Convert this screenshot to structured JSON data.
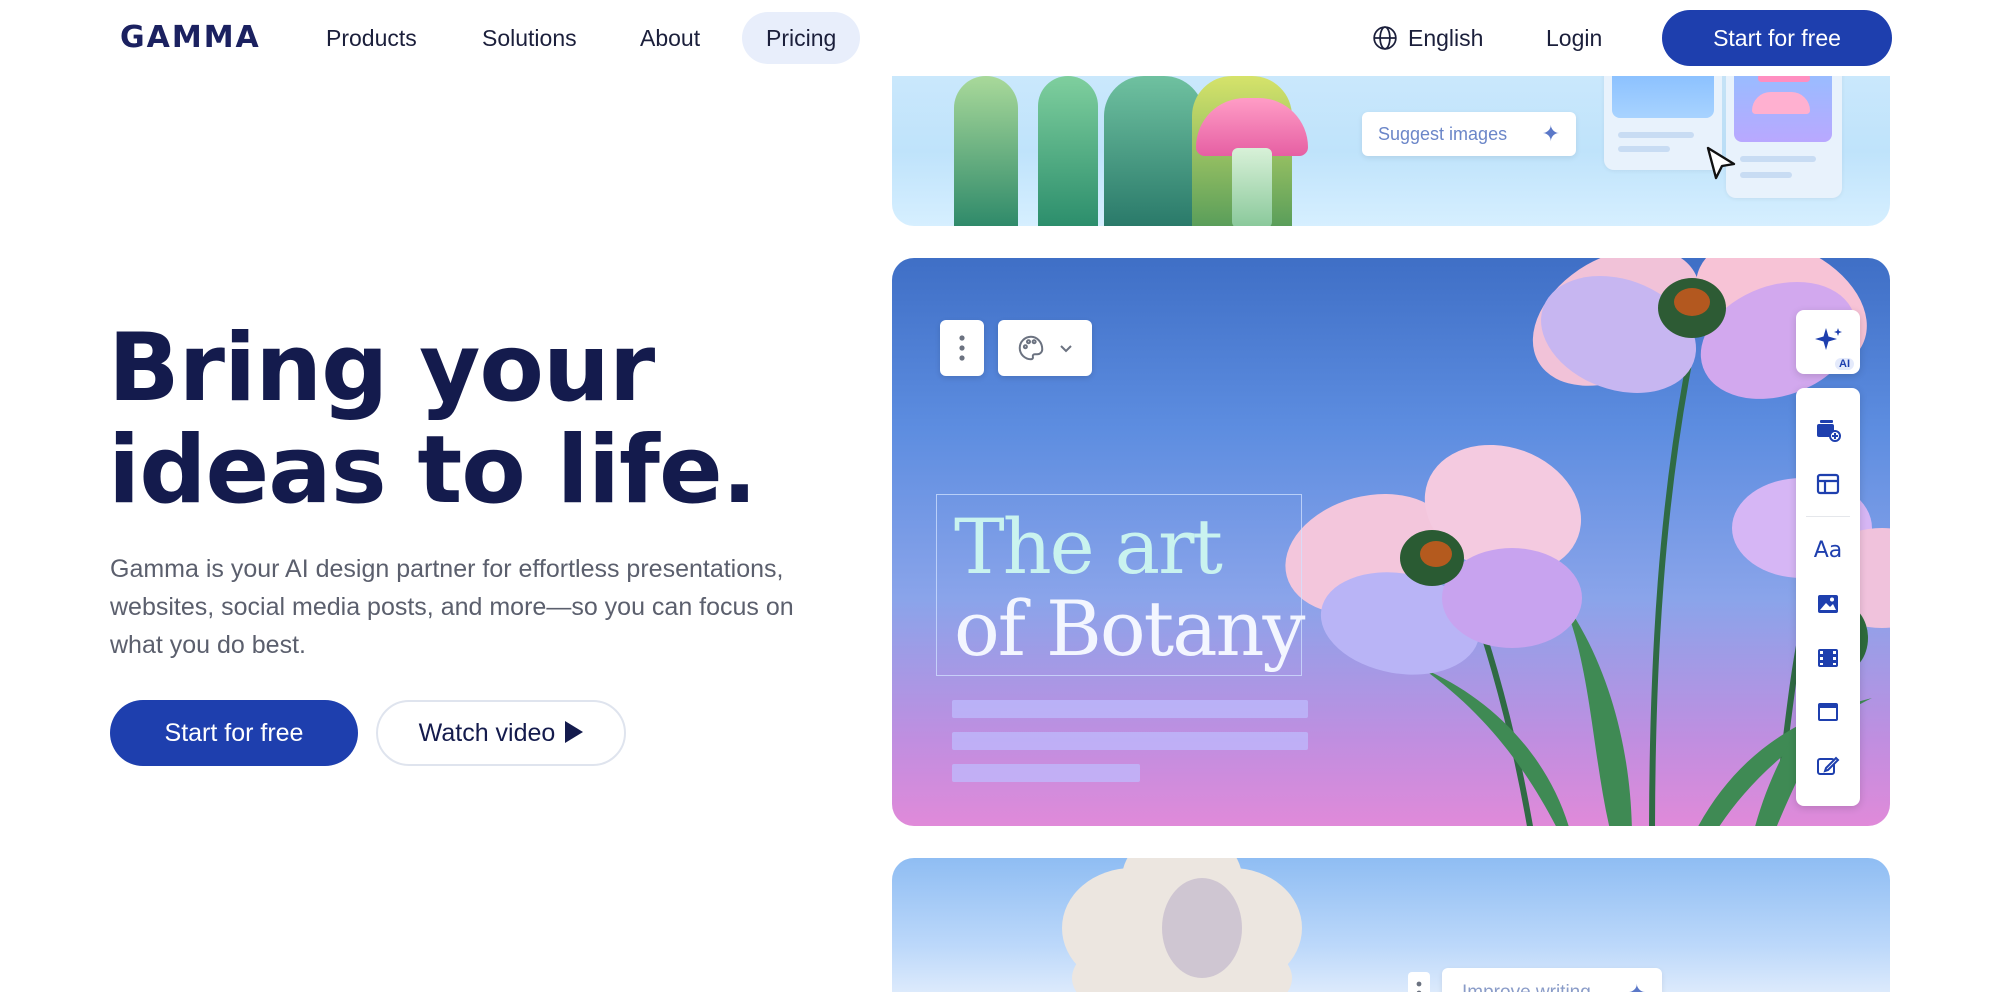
{
  "nav": {
    "logo": "GAMMA",
    "items": [
      {
        "label": "Products"
      },
      {
        "label": "Solutions"
      },
      {
        "label": "About"
      },
      {
        "label": "Pricing",
        "active": true
      }
    ],
    "language": "English",
    "login": "Login",
    "cta": "Start for free"
  },
  "hero": {
    "title_line1": "Bring your",
    "title_line2": "ideas to life.",
    "subtitle": "Gamma is your AI design partner for effortless presentations, websites, social media posts, and more—so you can focus on what you do best.",
    "primary_cta": "Start for free",
    "secondary_cta": "Watch video"
  },
  "preview": {
    "suggest_images": "Suggest images",
    "slide_title_line1": "The art",
    "slide_title_line2": "of Botany",
    "ai_badge": "AI",
    "improve_writing": "Improve writing",
    "side_icons": [
      "add-card-icon",
      "layout-icon",
      "text-icon",
      "image-icon",
      "video-icon",
      "embed-icon",
      "edit-icon"
    ]
  },
  "colors": {
    "brand_navy": "#141b4d",
    "brand_blue": "#1e3fae",
    "pricing_highlight": "#e8eefb"
  }
}
